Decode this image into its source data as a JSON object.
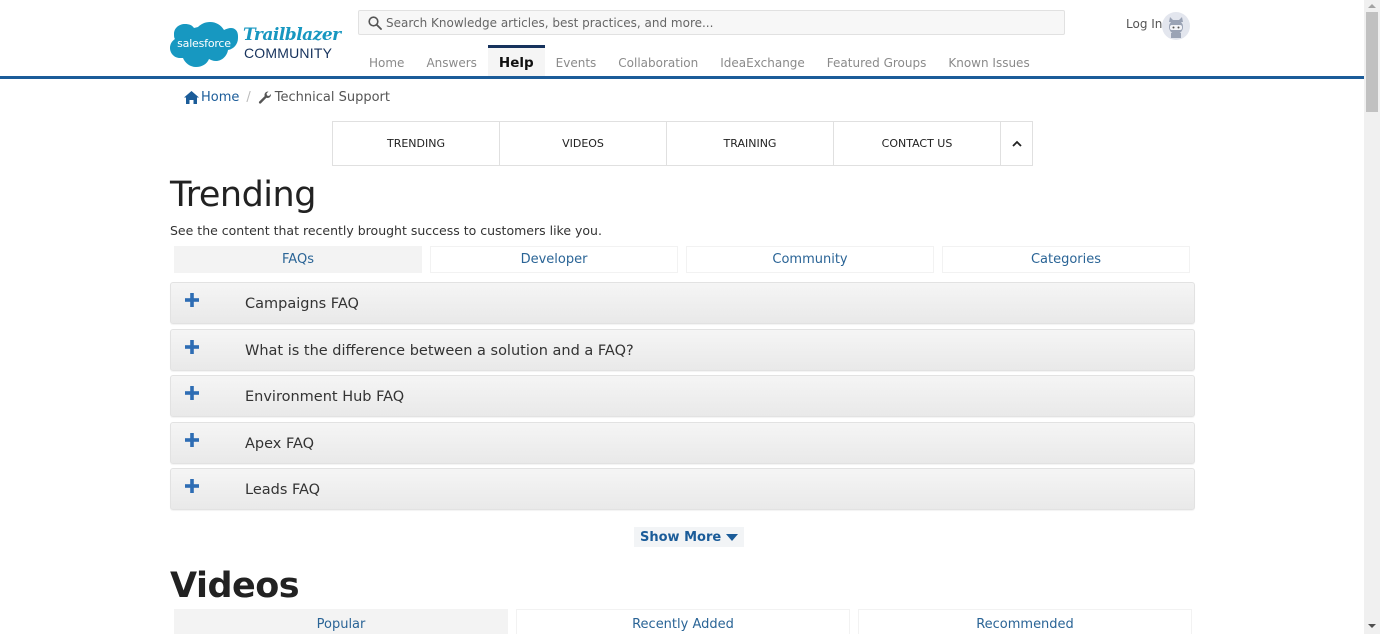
{
  "header": {
    "logo": {
      "brand": "salesforce",
      "title": "Trailblazer",
      "subtitle": "COMMUNITY"
    },
    "search": {
      "placeholder": "Search Knowledge articles, best practices, and more..."
    },
    "nav": [
      {
        "label": "Home",
        "active": false
      },
      {
        "label": "Answers",
        "active": false
      },
      {
        "label": "Help",
        "active": true
      },
      {
        "label": "Events",
        "active": false
      },
      {
        "label": "Collaboration",
        "active": false
      },
      {
        "label": "IdeaExchange",
        "active": false
      },
      {
        "label": "Featured Groups",
        "active": false
      },
      {
        "label": "Known Issues",
        "active": false
      }
    ],
    "login_label": "Log In"
  },
  "breadcrumb": {
    "home": "Home",
    "separator": "/",
    "current": "Technical Support"
  },
  "section_nav": {
    "items": [
      "TRENDING",
      "VIDEOS",
      "TRAINING",
      "CONTACT US"
    ],
    "toggle_icon": "chevron-up-icon"
  },
  "trending": {
    "title": "Trending",
    "subtitle": "See the content that recently brought success to customers like you.",
    "tabs": [
      {
        "label": "FAQs",
        "active": true
      },
      {
        "label": "Developer",
        "active": false
      },
      {
        "label": "Community",
        "active": false
      },
      {
        "label": "Categories",
        "active": false
      }
    ],
    "faqs": [
      "Campaigns FAQ",
      "What is the difference between a solution and a FAQ?",
      "Environment Hub FAQ",
      "Apex FAQ",
      "Leads FAQ"
    ],
    "show_more": "Show More"
  },
  "videos": {
    "title": "Videos",
    "tabs": [
      {
        "label": "Popular",
        "active": true
      },
      {
        "label": "Recently Added",
        "active": false
      },
      {
        "label": "Recommended",
        "active": false
      }
    ]
  },
  "colors": {
    "brand_blue": "#1b5c99",
    "header_rule": "#1b5c99",
    "salesforce_cloud": "#1798c1",
    "link": "#2a6496",
    "plus_icon": "#2e6db4"
  }
}
